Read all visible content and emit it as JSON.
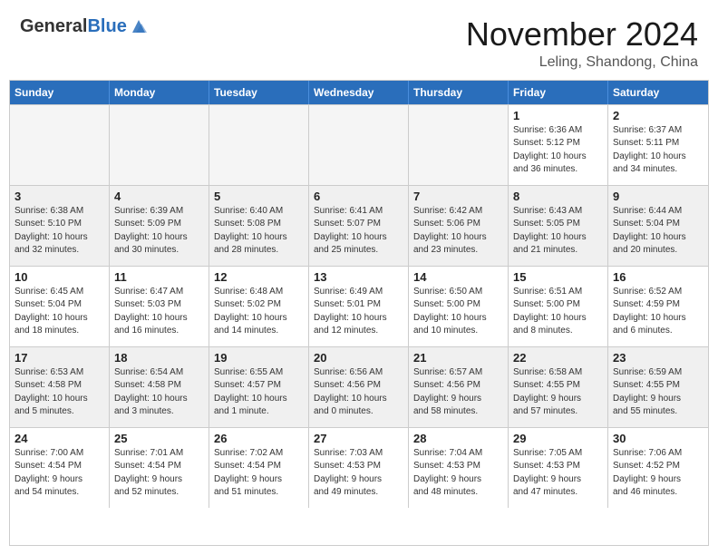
{
  "header": {
    "logo_general": "General",
    "logo_blue": "Blue",
    "month": "November 2024",
    "location": "Leling, Shandong, China"
  },
  "calendar": {
    "days_of_week": [
      "Sunday",
      "Monday",
      "Tuesday",
      "Wednesday",
      "Thursday",
      "Friday",
      "Saturday"
    ],
    "weeks": [
      [
        {
          "day": "",
          "info": "",
          "empty": true
        },
        {
          "day": "",
          "info": "",
          "empty": true
        },
        {
          "day": "",
          "info": "",
          "empty": true
        },
        {
          "day": "",
          "info": "",
          "empty": true
        },
        {
          "day": "",
          "info": "",
          "empty": true
        },
        {
          "day": "1",
          "info": "Sunrise: 6:36 AM\nSunset: 5:12 PM\nDaylight: 10 hours\nand 36 minutes.",
          "empty": false
        },
        {
          "day": "2",
          "info": "Sunrise: 6:37 AM\nSunset: 5:11 PM\nDaylight: 10 hours\nand 34 minutes.",
          "empty": false
        }
      ],
      [
        {
          "day": "3",
          "info": "Sunrise: 6:38 AM\nSunset: 5:10 PM\nDaylight: 10 hours\nand 32 minutes.",
          "empty": false
        },
        {
          "day": "4",
          "info": "Sunrise: 6:39 AM\nSunset: 5:09 PM\nDaylight: 10 hours\nand 30 minutes.",
          "empty": false
        },
        {
          "day": "5",
          "info": "Sunrise: 6:40 AM\nSunset: 5:08 PM\nDaylight: 10 hours\nand 28 minutes.",
          "empty": false
        },
        {
          "day": "6",
          "info": "Sunrise: 6:41 AM\nSunset: 5:07 PM\nDaylight: 10 hours\nand 25 minutes.",
          "empty": false
        },
        {
          "day": "7",
          "info": "Sunrise: 6:42 AM\nSunset: 5:06 PM\nDaylight: 10 hours\nand 23 minutes.",
          "empty": false
        },
        {
          "day": "8",
          "info": "Sunrise: 6:43 AM\nSunset: 5:05 PM\nDaylight: 10 hours\nand 21 minutes.",
          "empty": false
        },
        {
          "day": "9",
          "info": "Sunrise: 6:44 AM\nSunset: 5:04 PM\nDaylight: 10 hours\nand 20 minutes.",
          "empty": false
        }
      ],
      [
        {
          "day": "10",
          "info": "Sunrise: 6:45 AM\nSunset: 5:04 PM\nDaylight: 10 hours\nand 18 minutes.",
          "empty": false
        },
        {
          "day": "11",
          "info": "Sunrise: 6:47 AM\nSunset: 5:03 PM\nDaylight: 10 hours\nand 16 minutes.",
          "empty": false
        },
        {
          "day": "12",
          "info": "Sunrise: 6:48 AM\nSunset: 5:02 PM\nDaylight: 10 hours\nand 14 minutes.",
          "empty": false
        },
        {
          "day": "13",
          "info": "Sunrise: 6:49 AM\nSunset: 5:01 PM\nDaylight: 10 hours\nand 12 minutes.",
          "empty": false
        },
        {
          "day": "14",
          "info": "Sunrise: 6:50 AM\nSunset: 5:00 PM\nDaylight: 10 hours\nand 10 minutes.",
          "empty": false
        },
        {
          "day": "15",
          "info": "Sunrise: 6:51 AM\nSunset: 5:00 PM\nDaylight: 10 hours\nand 8 minutes.",
          "empty": false
        },
        {
          "day": "16",
          "info": "Sunrise: 6:52 AM\nSunset: 4:59 PM\nDaylight: 10 hours\nand 6 minutes.",
          "empty": false
        }
      ],
      [
        {
          "day": "17",
          "info": "Sunrise: 6:53 AM\nSunset: 4:58 PM\nDaylight: 10 hours\nand 5 minutes.",
          "empty": false
        },
        {
          "day": "18",
          "info": "Sunrise: 6:54 AM\nSunset: 4:58 PM\nDaylight: 10 hours\nand 3 minutes.",
          "empty": false
        },
        {
          "day": "19",
          "info": "Sunrise: 6:55 AM\nSunset: 4:57 PM\nDaylight: 10 hours\nand 1 minute.",
          "empty": false
        },
        {
          "day": "20",
          "info": "Sunrise: 6:56 AM\nSunset: 4:56 PM\nDaylight: 10 hours\nand 0 minutes.",
          "empty": false
        },
        {
          "day": "21",
          "info": "Sunrise: 6:57 AM\nSunset: 4:56 PM\nDaylight: 9 hours\nand 58 minutes.",
          "empty": false
        },
        {
          "day": "22",
          "info": "Sunrise: 6:58 AM\nSunset: 4:55 PM\nDaylight: 9 hours\nand 57 minutes.",
          "empty": false
        },
        {
          "day": "23",
          "info": "Sunrise: 6:59 AM\nSunset: 4:55 PM\nDaylight: 9 hours\nand 55 minutes.",
          "empty": false
        }
      ],
      [
        {
          "day": "24",
          "info": "Sunrise: 7:00 AM\nSunset: 4:54 PM\nDaylight: 9 hours\nand 54 minutes.",
          "empty": false
        },
        {
          "day": "25",
          "info": "Sunrise: 7:01 AM\nSunset: 4:54 PM\nDaylight: 9 hours\nand 52 minutes.",
          "empty": false
        },
        {
          "day": "26",
          "info": "Sunrise: 7:02 AM\nSunset: 4:54 PM\nDaylight: 9 hours\nand 51 minutes.",
          "empty": false
        },
        {
          "day": "27",
          "info": "Sunrise: 7:03 AM\nSunset: 4:53 PM\nDaylight: 9 hours\nand 49 minutes.",
          "empty": false
        },
        {
          "day": "28",
          "info": "Sunrise: 7:04 AM\nSunset: 4:53 PM\nDaylight: 9 hours\nand 48 minutes.",
          "empty": false
        },
        {
          "day": "29",
          "info": "Sunrise: 7:05 AM\nSunset: 4:53 PM\nDaylight: 9 hours\nand 47 minutes.",
          "empty": false
        },
        {
          "day": "30",
          "info": "Sunrise: 7:06 AM\nSunset: 4:52 PM\nDaylight: 9 hours\nand 46 minutes.",
          "empty": false
        }
      ]
    ]
  }
}
